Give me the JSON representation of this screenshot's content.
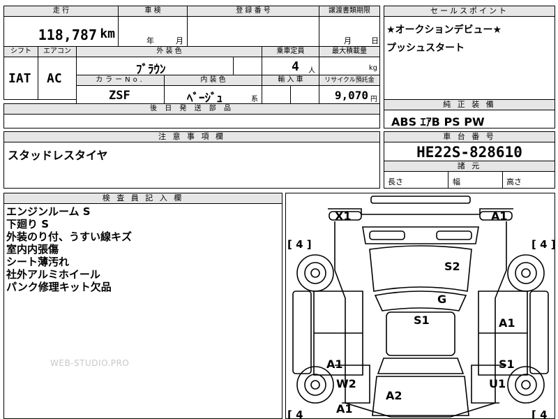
{
  "top_table": {
    "headers": {
      "mileage": "走 行",
      "inspection": "車 検",
      "registration": "登 録 番 号",
      "transfer_deadline": "譲渡書類期限"
    },
    "mileage_value": "118,787",
    "mileage_unit": "km",
    "inspection_year": "年",
    "inspection_month": "月",
    "deadline_month": "月",
    "deadline_day": "日",
    "headers2": {
      "shift": "シフト",
      "aircon": "エアコン",
      "exterior_color": "外 装 色",
      "capacity": "乗車定員",
      "max_load": "最大積載量"
    },
    "shift_value": "IAT",
    "aircon_value": "AC",
    "exterior_color_value": "ﾌﾞﾗｳﾝ",
    "capacity_value": "4",
    "capacity_unit": "人",
    "max_load_unit": "kg",
    "headers3": {
      "color_no": "カラーNo.",
      "interior_color": "内 装 色",
      "import": "輸 入 車",
      "recycle": "リサイクル預託金"
    },
    "color_no_value": "ZSF",
    "interior_color_value": "ﾍﾞｰｼﾞｭ",
    "interior_color_suffix": "系",
    "recycle_value": "9,070",
    "recycle_unit": "円",
    "later_parts_header": "後 日 発 送 部 品"
  },
  "sales_point": {
    "header": "セールスポイント",
    "lines": [
      "★オークションデビュー★",
      "プッシュスタート"
    ]
  },
  "standard_equipment": {
    "header": "純 正 装 備",
    "value": "ABS ｴｱB PS PW"
  },
  "caution": {
    "header": "注 意 事 項 欄",
    "value": "スタッドレスタイヤ"
  },
  "chassis": {
    "header": "車 台 番 号",
    "value": "HE22S-828610",
    "dimensions_header": "諸 元",
    "length": "長さ",
    "width": "幅",
    "height": "高さ"
  },
  "inspector": {
    "header": "検 査 員 記 入 欄",
    "notes": [
      "エンジンルーム S",
      "下廻り S",
      "外装のり付、うすい線キズ",
      "室内内張傷",
      "シート薄汚れ",
      "社外アルミホイール",
      "パンク修理キット欠品"
    ]
  },
  "watermark": "WEB-STUDIO.PRO",
  "diagram": {
    "tire_label_top_left": "[ 4 ]",
    "tire_label_top_right": "[ 4 ]",
    "tire_label_bottom_left": "[ 4",
    "tire_label_bottom_right": "[ 4",
    "marks": {
      "front_left": "X1",
      "front_right": "A1",
      "hood": "S2",
      "roof_front": "G",
      "roof": "S1",
      "right_front_door": "A1",
      "left_rear_door": "A1",
      "right_rear_door": "S1",
      "left_rear_fender": "W2",
      "right_rear_fender": "U1",
      "trunk": "A2",
      "rear_left": "A1"
    }
  }
}
